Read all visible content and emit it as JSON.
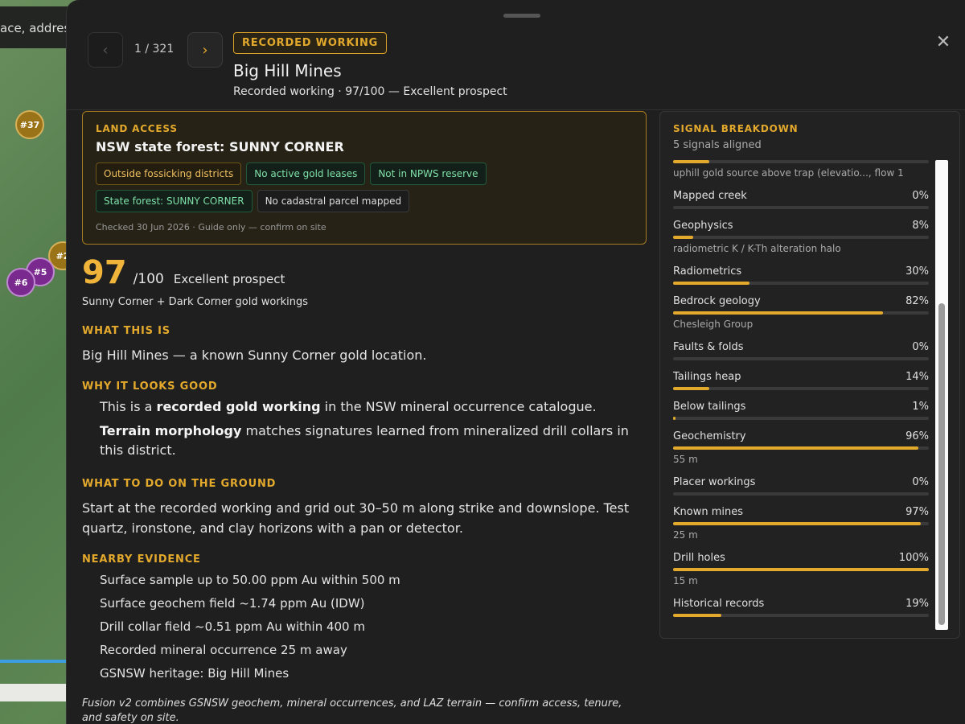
{
  "map": {
    "search_placeholder": "ace, address",
    "markers": [
      {
        "label": "#37",
        "kind": "gold"
      },
      {
        "label": "#2",
        "kind": "gold"
      },
      {
        "label": "#5",
        "kind": "purple"
      },
      {
        "label": "#6",
        "kind": "purple"
      }
    ]
  },
  "panel": {
    "close_glyph": "✕",
    "nav": {
      "prev_glyph": "‹",
      "next_glyph": "›",
      "position": "1 / 321"
    },
    "type_badge": "RECORDED WORKING",
    "title": "Big Hill Mines",
    "subtitle": "Recorded working · 97/100 — Excellent prospect"
  },
  "land_access": {
    "label": "LAND ACCESS",
    "title": "NSW state forest: SUNNY CORNER",
    "chips": [
      {
        "text": "Outside fossicking districts",
        "kind": "warn"
      },
      {
        "text": "No active gold leases",
        "kind": "ok"
      },
      {
        "text": "Not in NPWS reserve",
        "kind": "ok"
      },
      {
        "text": "State forest: SUNNY CORNER",
        "kind": "ok"
      },
      {
        "text": "No cadastral parcel mapped",
        "kind": "neutral"
      }
    ],
    "note": "Checked 30 Jun 2026 · Guide only — confirm on site"
  },
  "score": {
    "value": "97",
    "max": "/100",
    "label": "Excellent prospect",
    "district": "Sunny Corner + Dark Corner gold workings"
  },
  "what_this_is": {
    "label": "WHAT THIS IS",
    "text": "Big Hill Mines — a known Sunny Corner gold location."
  },
  "why_good": {
    "label": "WHY IT LOOKS GOOD",
    "items": [
      {
        "pre": "This is a ",
        "bold": "recorded gold working",
        "post": " in the NSW mineral occurrence catalogue."
      },
      {
        "pre": "",
        "bold": "Terrain morphology",
        "post": " matches signatures learned from mineralized drill collars in this district."
      }
    ]
  },
  "what_to_do": {
    "label": "WHAT TO DO ON THE GROUND",
    "text": "Start at the recorded working and grid out 30–50 m along strike and downslope. Test quartz, ironstone, and clay horizons with a pan or detector."
  },
  "nearby": {
    "label": "NEARBY EVIDENCE",
    "items": [
      "Surface sample up to 50.00 ppm Au within 500 m",
      "Surface geochem field ~1.74 ppm Au (IDW)",
      "Drill collar field ~0.51 ppm Au within 400 m",
      "Recorded mineral occurrence 25 m away",
      "GSNSW heritage: Big Hill Mines"
    ]
  },
  "footer_note": "Fusion v2 combines GSNSW geochem, mineral occurrences, and LAZ terrain — confirm access, tenure, and safety on site.",
  "signals": {
    "label": "SIGNAL BREAKDOWN",
    "count": "5 signals aligned",
    "accent": "#e3a92c",
    "rows": [
      {
        "name": "",
        "pct": "",
        "value": 0.14,
        "note": "uphill gold source above trap (elevatio..., flow 1"
      },
      {
        "name": "Mapped creek",
        "pct": "0%",
        "value": 0.0,
        "note": ""
      },
      {
        "name": "Geophysics",
        "pct": "8%",
        "value": 0.08,
        "note": "radiometric K / K-Th alteration halo"
      },
      {
        "name": "Radiometrics",
        "pct": "30%",
        "value": 0.3,
        "note": ""
      },
      {
        "name": "Bedrock geology",
        "pct": "82%",
        "value": 0.82,
        "note": "Chesleigh Group"
      },
      {
        "name": "Faults & folds",
        "pct": "0%",
        "value": 0.0,
        "note": ""
      },
      {
        "name": "Tailings heap",
        "pct": "14%",
        "value": 0.14,
        "note": ""
      },
      {
        "name": "Below tailings",
        "pct": "1%",
        "value": 0.01,
        "note": ""
      },
      {
        "name": "Geochemistry",
        "pct": "96%",
        "value": 0.96,
        "note": "55 m"
      },
      {
        "name": "Placer workings",
        "pct": "0%",
        "value": 0.0,
        "note": ""
      },
      {
        "name": "Known mines",
        "pct": "97%",
        "value": 0.97,
        "note": "25 m"
      },
      {
        "name": "Drill holes",
        "pct": "100%",
        "value": 1.0,
        "note": "15 m"
      },
      {
        "name": "Historical records",
        "pct": "19%",
        "value": 0.19,
        "note": ""
      }
    ]
  }
}
